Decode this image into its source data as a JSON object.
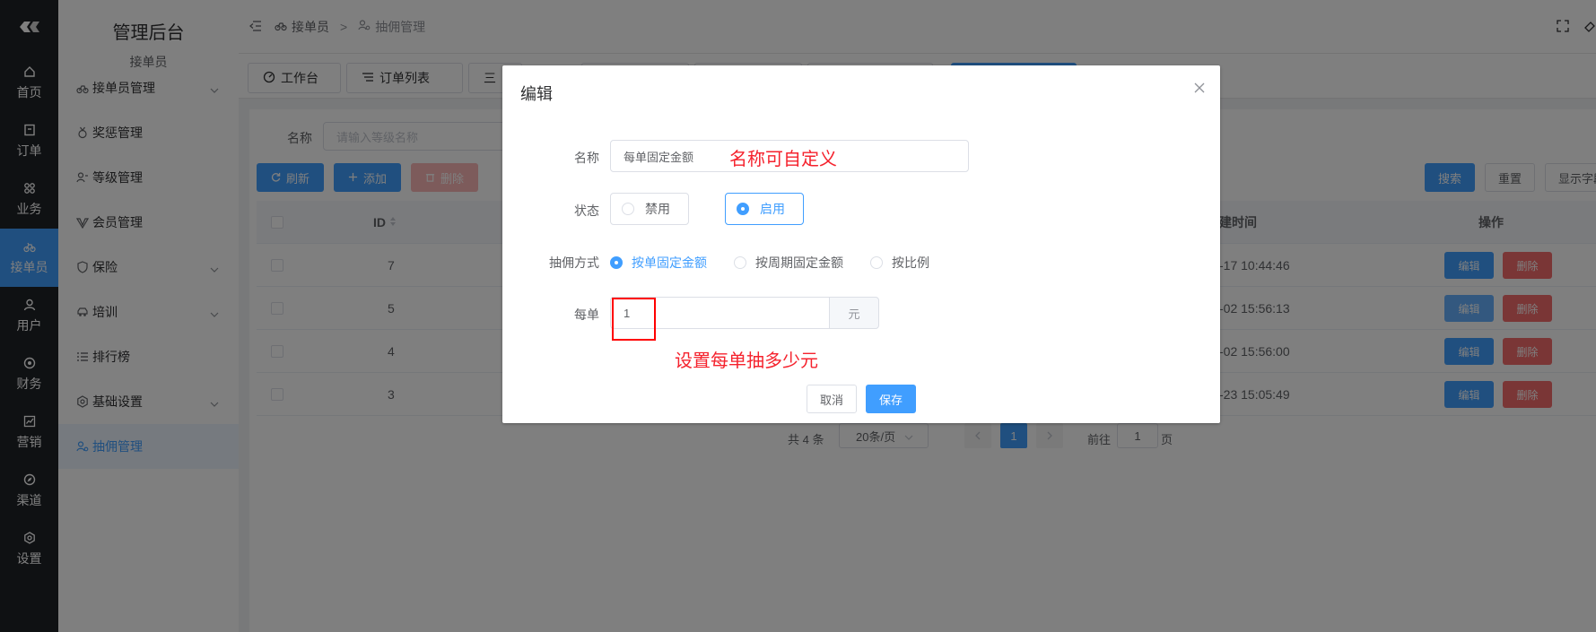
{
  "rail": {
    "items": [
      {
        "label": "首页",
        "icon": "home-icon"
      },
      {
        "label": "订单",
        "icon": "order-icon"
      },
      {
        "label": "业务",
        "icon": "grid-icon"
      },
      {
        "label": "接单员",
        "icon": "bike-icon"
      },
      {
        "label": "用户",
        "icon": "user-icon"
      },
      {
        "label": "财务",
        "icon": "coin-icon"
      },
      {
        "label": "营销",
        "icon": "chart-icon"
      },
      {
        "label": "渠道",
        "icon": "compass-icon"
      },
      {
        "label": "设置",
        "icon": "settings-icon"
      }
    ]
  },
  "sidebar": {
    "title": "管理后台",
    "subtitle": "接单员",
    "items": [
      {
        "label": "接单员管理"
      },
      {
        "label": "奖惩管理"
      },
      {
        "label": "等级管理"
      },
      {
        "label": "会员管理"
      },
      {
        "label": "保险"
      },
      {
        "label": "培训"
      },
      {
        "label": "排行榜"
      },
      {
        "label": "基础设置"
      },
      {
        "label": "抽佣管理"
      }
    ]
  },
  "header": {
    "breadcrumb_1": "接单员",
    "separator": ">",
    "breadcrumb_2": "抽佣管理"
  },
  "tabs": {
    "tab_1": "工作台",
    "tab_2": "订单列表",
    "tab_3": "三"
  },
  "filter": {
    "label": "名称",
    "placeholder": "请输入等级名称"
  },
  "toolbar": {
    "refresh": "刷新",
    "add": "添加",
    "delete": "删除",
    "search": "搜索",
    "reset": "重置",
    "show_fields": "显示字段"
  },
  "table": {
    "col_id": "ID",
    "col_created": "建时间",
    "col_actions": "操作",
    "edit_label": "编辑",
    "delete_label": "删除",
    "rows": [
      {
        "id": "7",
        "created": "-17 10:44:46"
      },
      {
        "id": "5",
        "created": "-02 15:56:13"
      },
      {
        "id": "4",
        "created": "-02 15:56:00"
      },
      {
        "id": "3",
        "created": "-23 15:05:49"
      }
    ]
  },
  "pagination": {
    "total": "共 4 条",
    "page_size": "20条/页",
    "current_page": "1",
    "goto_prefix": "前往",
    "goto_value": "1",
    "goto_suffix": "页"
  },
  "dialog": {
    "title": "编辑",
    "name_label": "名称",
    "name_value": "每单固定金额",
    "name_annotation": "名称可自定义",
    "status_label": "状态",
    "status_disabled": "禁用",
    "status_enabled": "启用",
    "mode_label": "抽佣方式",
    "mode_option_1": "按单固定金额",
    "mode_option_2": "按周期固定金额",
    "mode_option_3": "按比例",
    "per_order_label": "每单",
    "per_order_value": "1",
    "per_order_unit": "元",
    "per_order_annotation": "设置每单抽多少元",
    "cancel": "取消",
    "save": "保存"
  },
  "colors": {
    "primary": "#409eff",
    "danger": "#f56c6c",
    "annotation": "#f5222d",
    "rail_bg": "#1f2227"
  }
}
